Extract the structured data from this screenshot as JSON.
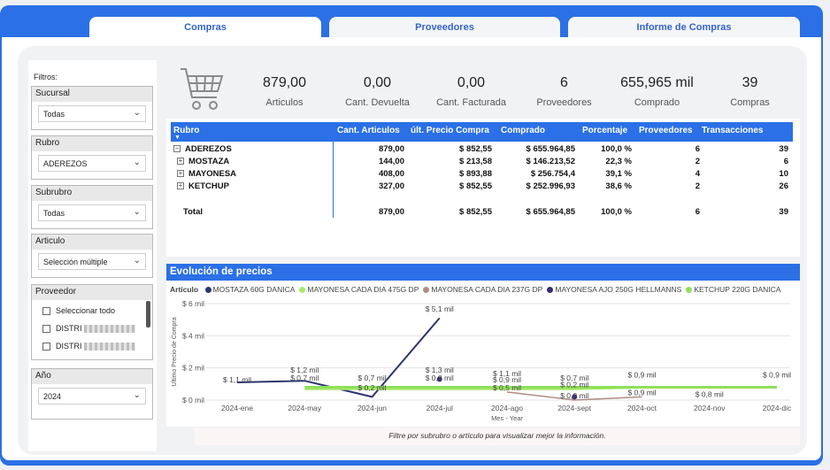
{
  "tabs": [
    {
      "label": "Compras",
      "active": true
    },
    {
      "label": "Proveedores",
      "active": false
    },
    {
      "label": "Informe de Compras",
      "active": false
    }
  ],
  "filters": {
    "title": "Filtros:",
    "sucursal": {
      "label": "Sucursal",
      "value": "Todas"
    },
    "rubro": {
      "label": "Rubro",
      "value": "ADEREZOS"
    },
    "subrubro": {
      "label": "Subrubro",
      "value": "Todas"
    },
    "articulo": {
      "label": "Articulo",
      "value": "Selección múltiple"
    },
    "proveedor": {
      "label": "Proveedor",
      "select_all": "Seleccionar todo",
      "items": [
        "DISTRI",
        "DISTRI"
      ]
    },
    "anio": {
      "label": "Año",
      "value": "2024"
    }
  },
  "kpis": [
    {
      "value": "879,00",
      "label": "Articulos"
    },
    {
      "value": "0,00",
      "label": "Cant. Devuelta"
    },
    {
      "value": "0,00",
      "label": "Cant. Facturada"
    },
    {
      "value": "6",
      "label": "Proveedores"
    },
    {
      "value": "655,965 mil",
      "label": "Comprado"
    },
    {
      "value": "39",
      "label": "Compras"
    }
  ],
  "table": {
    "headers": [
      "Rubro",
      "Cant. Articulos",
      "últ. Precio Compra",
      "Comprado",
      "Porcentaje",
      "Proveedores",
      "Transacciones"
    ],
    "rows": [
      {
        "name": "ADEREZOS",
        "expand": "⊟",
        "cant": "879,00",
        "precio": "$ 852,55",
        "comprado": "$ 655.964,85",
        "pct": "100,0 %",
        "prov": "6",
        "trans": "39"
      },
      {
        "name": "MOSTAZA",
        "expand": "⊞",
        "cant": "144,00",
        "precio": "$ 213,58",
        "comprado": "$ 146.213,52",
        "pct": "22,3 %",
        "prov": "2",
        "trans": "6"
      },
      {
        "name": "MAYONESA",
        "expand": "⊞",
        "cant": "408,00",
        "precio": "$ 893,88",
        "comprado": "$ 256.754,4",
        "pct": "39,1 %",
        "prov": "4",
        "trans": "10"
      },
      {
        "name": "KETCHUP",
        "expand": "⊞",
        "cant": "327,00",
        "precio": "$ 852,55",
        "comprado": "$ 252.996,93",
        "pct": "38,6 %",
        "prov": "2",
        "trans": "26"
      }
    ],
    "total": {
      "name": "Total",
      "cant": "879,00",
      "precio": "$ 852,55",
      "comprado": "$ 655.964,85",
      "pct": "100,0 %",
      "prov": "6",
      "trans": "39"
    }
  },
  "chart_title": "Evolución de precios",
  "legend_label": "Artículo",
  "chart_data": {
    "type": "line",
    "ylabel": "Ultimo Precio de Compra",
    "xlabel": "Mes - Year",
    "categories": [
      "2024-ene",
      "2024-may",
      "2024-jun",
      "2024-jul",
      "2024-ago",
      "2024-sept",
      "2024-oct",
      "2024-nov",
      "2024-dic"
    ],
    "yticks": [
      "$ 0 mil",
      "$ 2 mil",
      "$ 4 mil",
      "$ 6 mil"
    ],
    "ylim": [
      0,
      6
    ],
    "grid": true,
    "legend_position": "top",
    "series": [
      {
        "name": "MOSTAZA 60G DANICA",
        "color": "#2d3470",
        "values": [
          1.1,
          1.2,
          0.2,
          5.1,
          null,
          null,
          null,
          null,
          null
        ]
      },
      {
        "name": "MAYONESA CADA DIA 475G DP",
        "color": "#a7ea6b",
        "values": [
          null,
          0.7,
          0.7,
          0.7,
          0.7,
          0.7,
          0.8,
          0.8,
          0.8
        ]
      },
      {
        "name": "MAYONESA CADA DIA 237G DP",
        "color": "#b08b82",
        "values": [
          null,
          null,
          null,
          null,
          0.5,
          0.0,
          0.2,
          null,
          null
        ]
      },
      {
        "name": "MAYONESA AJO 250G HELLMANNS",
        "color": "#3b2a78",
        "values": [
          null,
          null,
          null,
          1.3,
          null,
          0.2,
          null,
          null,
          null
        ]
      },
      {
        "name": "KETCHUP 220G DANICA",
        "color": "#8fe05a",
        "values": [
          null,
          0.8,
          0.8,
          0.8,
          0.8,
          0.8,
          0.8,
          0.8,
          0.8
        ]
      }
    ],
    "data_labels": [
      {
        "text": "$ 1,1 mil",
        "x": "2024-ene",
        "y": 1.1
      },
      {
        "text": "$ 1,2 mil",
        "x": "2024-may",
        "y": 1.7
      },
      {
        "text": "$ 0,7 mil",
        "x": "2024-may",
        "y": 1.2
      },
      {
        "text": "$ 5,1 mil",
        "x": "2024-jul",
        "y": 5.5
      },
      {
        "text": "$ 0,7 mil",
        "x": "2024-jun",
        "y": 1.2
      },
      {
        "text": "$ 0,2 mil",
        "x": "2024-jun",
        "y": 0.6
      },
      {
        "text": "$ 1,3 mil",
        "x": "2024-jul",
        "y": 1.7
      },
      {
        "text": "$ 0,8 mil",
        "x": "2024-jul",
        "y": 1.2
      },
      {
        "text": "$ 1,1 mil",
        "x": "2024-ago",
        "y": 1.5
      },
      {
        "text": "$ 0,9 mil",
        "x": "2024-ago",
        "y": 1.1
      },
      {
        "text": "$ 0,5 mil",
        "x": "2024-ago",
        "y": 0.6
      },
      {
        "text": "$ 0,7 mil",
        "x": "2024-sept",
        "y": 1.2
      },
      {
        "text": "$ 0,2 mil",
        "x": "2024-sept",
        "y": 0.8
      },
      {
        "text": "$ 0,0 mil",
        "x": "2024-sept",
        "y": 0.1
      },
      {
        "text": "$ 0,9 mil",
        "x": "2024-oct",
        "y": 1.4
      },
      {
        "text": "$ 0,9 mil",
        "x": "2024-oct",
        "y": 0.3
      },
      {
        "text": "$ 0,8 mil",
        "x": "2024-nov",
        "y": 0.2
      },
      {
        "text": "$ 0,9 mil",
        "x": "2024-dic",
        "y": 1.4
      }
    ]
  },
  "note": "Filtre por subrubro o artículo para visualizar mejor la información."
}
